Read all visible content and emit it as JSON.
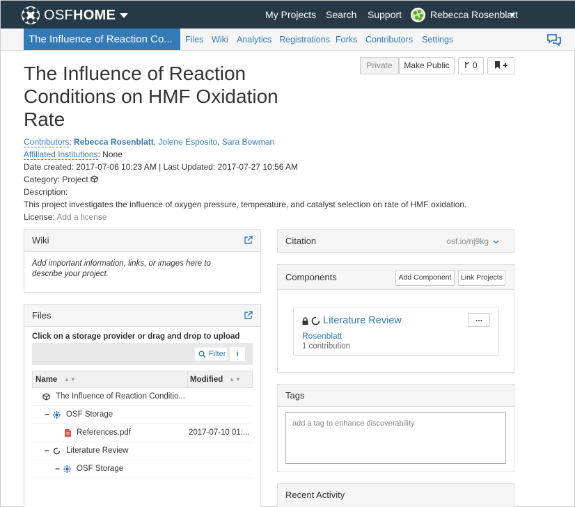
{
  "topnav": {
    "brand_light": "OSF",
    "brand_bold": "HOME",
    "links": [
      "My Projects",
      "Search",
      "Support"
    ],
    "user_name": "Rebecca Rosenblatt"
  },
  "projnav": {
    "title": "The Influence of Reaction Co...",
    "tabs": [
      "Files",
      "Wiki",
      "Analytics",
      "Registrations",
      "Forks",
      "Contributors",
      "Settings"
    ]
  },
  "header": {
    "title": "The Influence of Reaction Conditions on HMF Oxidation Rate",
    "private_label": "Private",
    "make_public_label": "Make Public",
    "fork_count": "0"
  },
  "meta": {
    "contributors_label": "Contributors",
    "contributors": [
      "Rebecca Rosenblatt",
      "Jolene Esposito",
      "Sara Bowman"
    ],
    "affiliated_label": "Affiliated Institutions",
    "affiliated_value": ": None",
    "dates": "Date created: 2017-07-06 10:23 AM | Last Updated: 2017-07-27 10:56 AM",
    "category_label": "Category: Project",
    "description_label": "Description:",
    "description": "This project investigates the influence of oxygen pressure, temperature, and catalyst selection on rate of HMF oxidation.",
    "license_label": "License:",
    "license_link": "Add a license"
  },
  "wiki": {
    "title": "Wiki",
    "placeholder": "Add important information, links, or images here to describe your project."
  },
  "files": {
    "title": "Files",
    "instruction": "Click on a storage provider or drag and drop to upload",
    "filter_label": "Filter",
    "info_label": "i",
    "col_name": "Name",
    "col_modified": "Modified",
    "rows": [
      {
        "name": "The Influence of Reaction Conditio...",
        "modified": "",
        "icon": "project-cube-icon"
      },
      {
        "name": "OSF Storage",
        "modified": "",
        "icon": "osf-storage-icon"
      },
      {
        "name": "References.pdf",
        "modified": "2017-07-10 01:...",
        "icon": "pdf-file-icon"
      },
      {
        "name": "Literature Review",
        "modified": "",
        "icon": "component-circle-icon"
      },
      {
        "name": "OSF Storage",
        "modified": "",
        "icon": "osf-storage-icon"
      }
    ]
  },
  "citation": {
    "title": "Citation",
    "url": "osf.io/nj9kg"
  },
  "components": {
    "title": "Components",
    "add_label": "Add Component",
    "link_label": "Link Projects",
    "item_title": "Literature Review",
    "item_author": "Rosenblatt",
    "item_count": "1 contribution",
    "menu_label": "..."
  },
  "tags": {
    "title": "Tags",
    "placeholder": "add a tag to enhance discoverability"
  },
  "recent": {
    "title": "Recent Activity"
  },
  "colors": {
    "navbar": "#263947",
    "accent": "#337ab7"
  }
}
